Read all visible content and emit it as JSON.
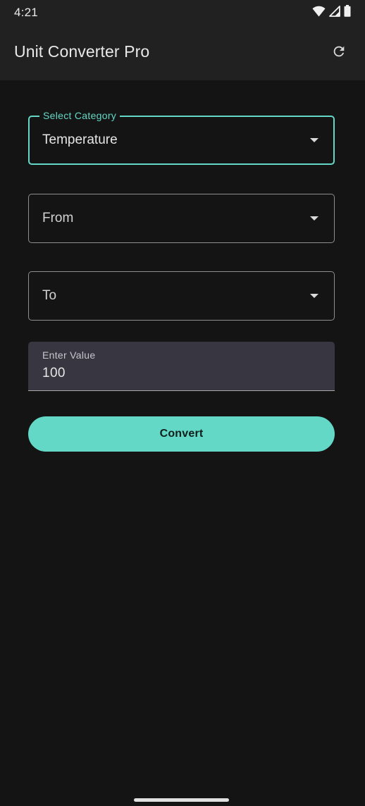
{
  "status_bar": {
    "time": "4:21",
    "icons": [
      "wifi-icon",
      "cellular-signal-icon",
      "battery-icon"
    ]
  },
  "app_bar": {
    "title": "Unit Converter Pro",
    "action_icon": "refresh-icon"
  },
  "form": {
    "category": {
      "label": "Select Category",
      "value": "Temperature"
    },
    "from": {
      "label": "From",
      "value": ""
    },
    "to": {
      "label": "To",
      "value": ""
    },
    "input": {
      "label": "Enter Value",
      "value": "100"
    },
    "convert_label": "Convert"
  },
  "colors": {
    "accent": "#63d8c6",
    "background": "#141414",
    "app_bar": "#212121",
    "filled_field": "#383640"
  }
}
